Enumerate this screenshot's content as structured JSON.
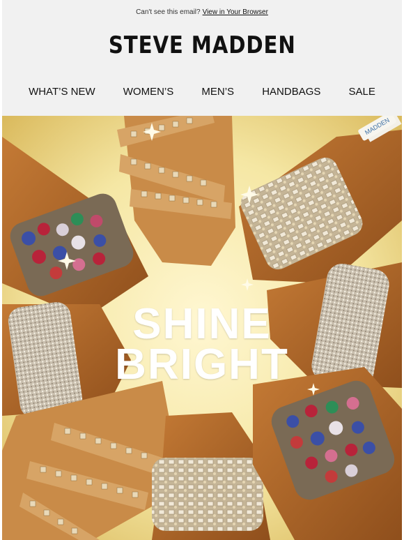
{
  "preheader": {
    "text": "Can't see this email?",
    "link": "View in Your Browser"
  },
  "brand": {
    "logo_text": "STEVE MADDEN"
  },
  "nav": {
    "items": [
      "WHAT’S NEW",
      "WOMEN’S",
      "MEN’S",
      "HANDBAGS",
      "SALE"
    ]
  },
  "hero": {
    "title_line1": "SHINE",
    "title_line2": "BRIGHT",
    "insole_tag": "MADDEN"
  }
}
